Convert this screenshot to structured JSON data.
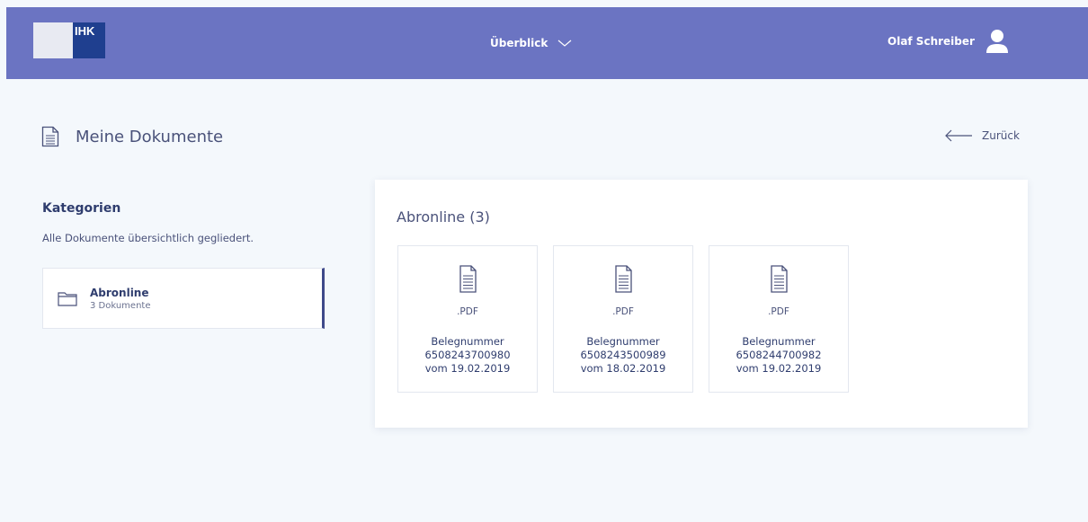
{
  "header": {
    "logo_text": "IHK",
    "nav_label": "Überblick",
    "user_name": "Olaf Schreiber"
  },
  "page": {
    "title": "Meine Dokumente",
    "back_label": "Zurück"
  },
  "sidebar": {
    "heading": "Kategorien",
    "subtitle": "Alle Dokumente übersichtlich gegliedert.",
    "categories": [
      {
        "name": "Abronline",
        "count": "3 Dokumente"
      }
    ]
  },
  "content": {
    "title": "Abronline (3)",
    "documents": [
      {
        "type": ".PDF",
        "label": "Belegnummer",
        "number": "6508243700980",
        "date": "vom 19.02.2019"
      },
      {
        "type": ".PDF",
        "label": "Belegnummer",
        "number": "6508243500989",
        "date": "vom 18.02.2019"
      },
      {
        "type": ".PDF",
        "label": "Belegnummer",
        "number": "6508244700982",
        "date": "vom 19.02.2019"
      }
    ]
  },
  "icons": {
    "document": "document-icon",
    "folder": "folder-icon",
    "user": "user-icon",
    "chevron": "chevron-down-icon",
    "back": "arrow-left-icon"
  },
  "colors": {
    "header_bg": "#6b74c2",
    "logo_blue": "#1f3f8f",
    "text_primary": "#2f3d6e",
    "active_border": "#3f4a8a",
    "page_bg": "#f4f8fc"
  }
}
